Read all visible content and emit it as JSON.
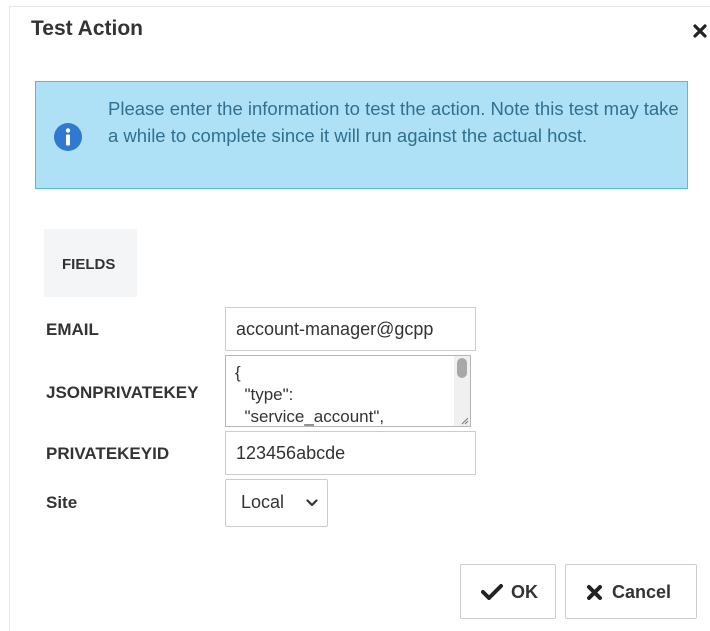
{
  "dialog": {
    "title": "Test Action",
    "close_icon": "close-icon"
  },
  "alert": {
    "icon": "info-icon",
    "message": "Please enter the information to test the action. Note this test may take a while to complete since it will run against the actual host.",
    "background": "#aee1f5",
    "border": "#5bb8dc",
    "text_color": "#31708f"
  },
  "fields_tab": {
    "label": "FIELDS"
  },
  "form": {
    "email": {
      "label": "EMAIL",
      "value": "account-manager@gcpp"
    },
    "jsonprivatekey": {
      "label": "JSONPRIVATEKEY",
      "value": "{\n  \"type\":\n  \"service_account\","
    },
    "privatekeyid": {
      "label": "PRIVATEKEYID",
      "value": "123456abcde"
    },
    "site": {
      "label": "Site",
      "selected": "Local"
    }
  },
  "buttons": {
    "ok": {
      "label": "OK",
      "icon": "check-icon"
    },
    "cancel": {
      "label": "Cancel",
      "icon": "close-icon"
    }
  }
}
